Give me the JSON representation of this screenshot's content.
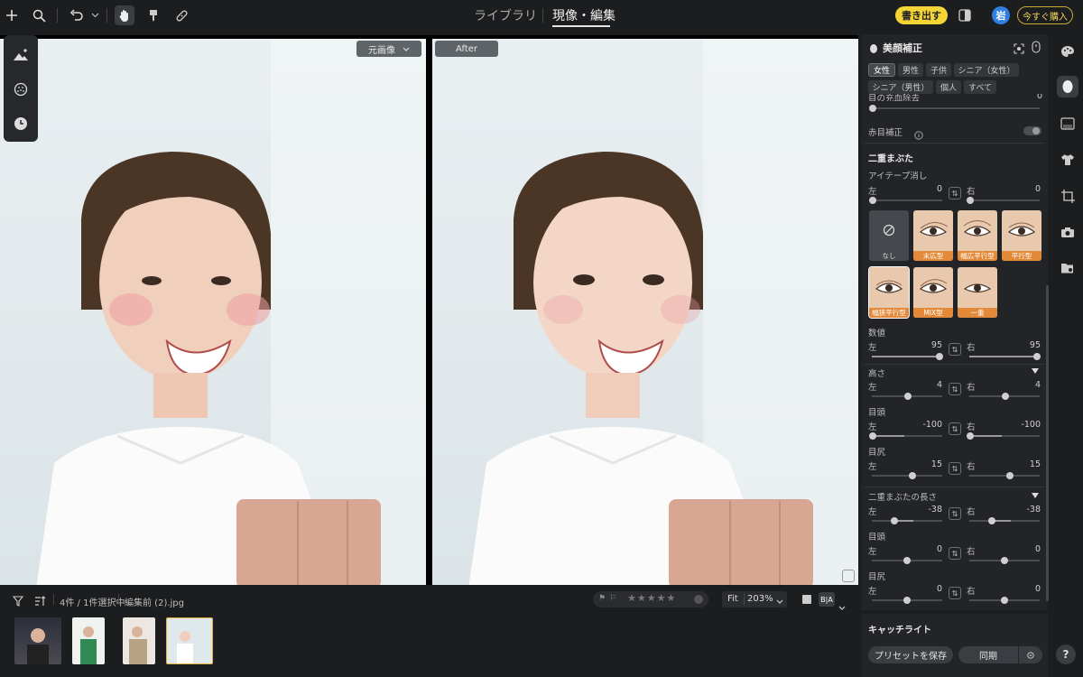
{
  "topbar": {
    "tabs": [
      {
        "label": "ライブラリ"
      },
      {
        "label": "現像・編集"
      }
    ],
    "export_label": "書き出す",
    "avatar_label": "岩",
    "buy_label": "今すぐ購入"
  },
  "preview": {
    "before_label": "元画像",
    "after_label": "After"
  },
  "filmstrip": {
    "count_label": "4件 / 1件選択中",
    "filename": "編集前 (2).jpg",
    "fit_label": "Fit",
    "zoom_label": "203%"
  },
  "panel": {
    "title": "美顔補正",
    "gender_chips": [
      "女性",
      "男性",
      "子供",
      "シニア（女性）",
      "シニア（男性）",
      "個人",
      "すべて"
    ],
    "top_cut_label": "目の充血除去",
    "top_cut_value": "0",
    "red_eye_label": "赤目補正",
    "double_eyelid_section": "二重まぶた",
    "eyetape_label": "アイテープ消し",
    "left_label": "左",
    "right_label": "右",
    "eyetape_left_value": "0",
    "eyetape_right_value": "0",
    "shape_none_label": "なし",
    "shapes": [
      "末広型",
      "幅広平行型",
      "平行型",
      "幅狭平行型",
      "MIX型",
      "一重"
    ],
    "amount_label": "数値",
    "amount_left": "95",
    "amount_right": "95",
    "height_label": "高さ",
    "height_left": "4",
    "height_right": "4",
    "inner_label": "目頭",
    "inner_left": "-100",
    "inner_right": "-100",
    "outer_label": "目尻",
    "outer_left": "15",
    "outer_right": "15",
    "length_section": "二重まぶたの長さ",
    "length_left": "-38",
    "length_right": "-38",
    "len_inner_label": "目頭",
    "len_inner_left": "0",
    "len_inner_right": "0",
    "len_outer_label": "目尻",
    "len_outer_left": "0",
    "len_outer_right": "0",
    "catchlight_label": "キャッチライト",
    "save_preset_label": "プリセットを保存",
    "sync_label": "同期"
  },
  "colors": {
    "accent_yellow": "#f5d535",
    "accent_blue": "#2f7fe0",
    "swatch_caption": "#e38a3a"
  }
}
